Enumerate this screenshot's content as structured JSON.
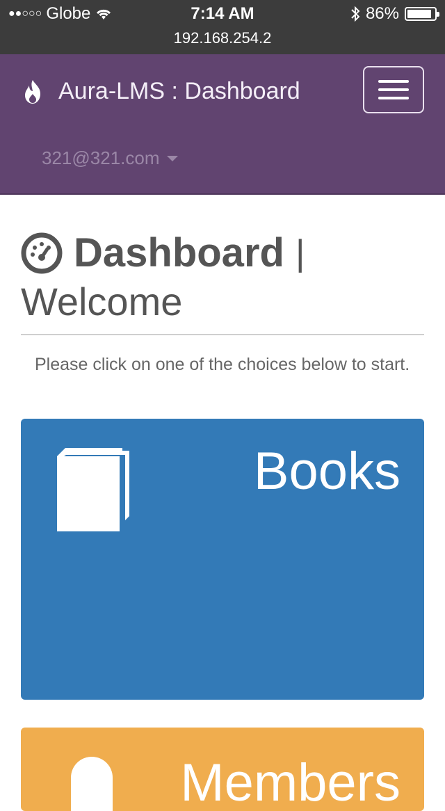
{
  "status_bar": {
    "carrier": "Globe",
    "time": "7:14 AM",
    "battery": "86%",
    "url": "192.168.254.2",
    "signal_dots": "●●○○○"
  },
  "navbar": {
    "brand": "Aura-LMS : Dashboard",
    "user": "321@321.com",
    "color": "#614470"
  },
  "header": {
    "title": "Dashboard",
    "separator": "|",
    "subtitle": "Welcome"
  },
  "intro": "Please click on one of the choices below to start.",
  "cards": [
    {
      "label": "Books",
      "color": "#337ab7",
      "icon": "book-icon"
    },
    {
      "label": "Members",
      "color": "#f0ad4e",
      "icon": "user-icon"
    }
  ]
}
